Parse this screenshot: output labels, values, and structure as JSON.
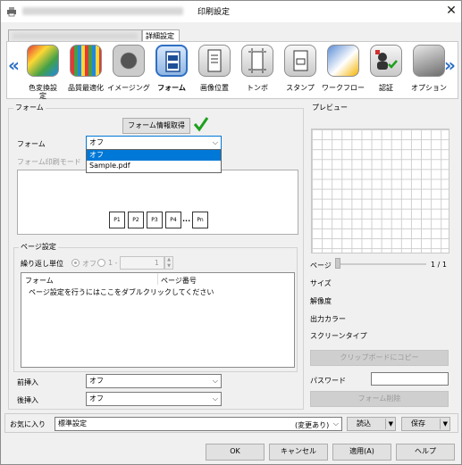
{
  "window": {
    "title": "印刷設定",
    "tabs": [
      "",
      "詳細設定"
    ],
    "close_icon": "close-icon"
  },
  "toolbar": {
    "items": [
      {
        "label": "色変換設\n定",
        "icon": "color-conversion-icon"
      },
      {
        "label": "品質最適化",
        "icon": "quality-grid-icon"
      },
      {
        "label": "イメージング",
        "icon": "imaging-icon"
      },
      {
        "label": "フォーム",
        "icon": "form-icon"
      },
      {
        "label": "画像位置",
        "icon": "image-position-icon"
      },
      {
        "label": "トンボ",
        "icon": "crop-mark-icon"
      },
      {
        "label": "スタンプ",
        "icon": "stamp-icon"
      },
      {
        "label": "ワークフロー",
        "icon": "workflow-icon"
      },
      {
        "label": "認証",
        "icon": "authentication-icon"
      },
      {
        "label": "オプション",
        "icon": "option-icon"
      }
    ],
    "selected": "フォーム"
  },
  "form": {
    "group_label": "フォーム",
    "get_info_button": "フォーム情報取得",
    "form_label": "フォーム",
    "form_value": "オフ",
    "dropdown_options": [
      "オフ",
      "Sample.pdf"
    ],
    "print_mode_label": "フォーム印刷モード",
    "pages": [
      "P1",
      "P2",
      "P3",
      "P4",
      "...",
      "Pn"
    ]
  },
  "page_settings": {
    "group_label": "ページ設定",
    "repeat_label": "繰り返し単位",
    "radio_off": "オフ",
    "radio_one": "1 -",
    "spin_value": "1",
    "col_form": "フォーム",
    "col_page": "ページ番号",
    "hint": "ページ設定を行うにはここをダブルクリックしてください"
  },
  "inserts": {
    "front_label": "前挿入",
    "front_value": "オフ",
    "back_label": "後挿入",
    "back_value": "オフ"
  },
  "preview": {
    "group_label": "プレビュー",
    "page_label": "ページ",
    "page_count": "1 / 1",
    "size_label": "サイズ",
    "resolution_label": "解像度",
    "color_label": "出力カラー",
    "screen_label": "スクリーンタイプ",
    "copy_button": "クリップボードにコピー",
    "password_label": "パスワード",
    "delete_button": "フォーム削除"
  },
  "favorites": {
    "label": "お気に入り",
    "value": "標準設定",
    "changed": "(変更あり)",
    "load_button": "読込",
    "save_button": "保存"
  },
  "footer": {
    "ok": "OK",
    "cancel": "キャンセル",
    "apply": "適用(A)",
    "help": "ヘルプ"
  },
  "colors": {
    "accent": "#0078d7",
    "toolbar_selected": "#2f6fc2",
    "check": "#1ea01e"
  }
}
